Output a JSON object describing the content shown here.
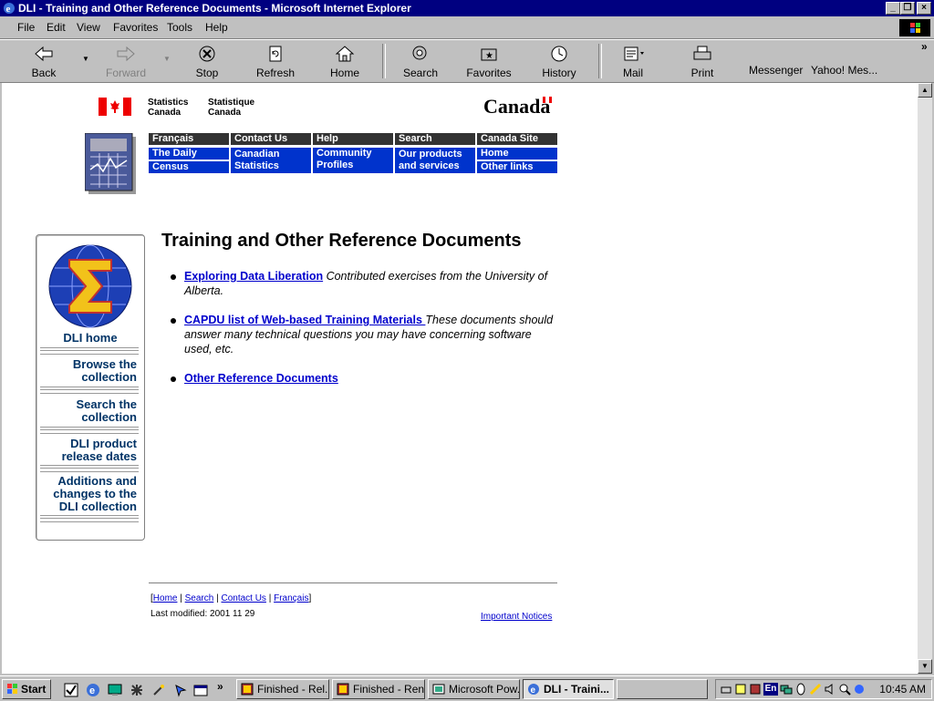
{
  "window": {
    "title": "DLI - Training and Other Reference Documents - Microsoft Internet Explorer"
  },
  "menu": [
    "File",
    "Edit",
    "View",
    "Favorites",
    "Tools",
    "Help"
  ],
  "toolbar": {
    "back": "Back",
    "forward": "Forward",
    "stop": "Stop",
    "refresh": "Refresh",
    "home": "Home",
    "search": "Search",
    "favorites": "Favorites",
    "history": "History",
    "mail": "Mail",
    "print": "Print",
    "messenger": "Messenger",
    "yahoo": "Yahoo! Mes...",
    "chevron": "»"
  },
  "header": {
    "stats_en_1": "Statistics",
    "stats_en_2": "Canada",
    "stats_fr_1": "Statistique",
    "stats_fr_2": "Canada",
    "canada_wordmark": "Canada"
  },
  "nav": {
    "francais": "Français",
    "contact": "Contact Us",
    "help": "Help",
    "search": "Search",
    "canada_site": "Canada Site",
    "daily": "The Daily",
    "census": "Census",
    "canadian_stats_1": "Canadian",
    "canadian_stats_2": "Statistics",
    "community_1": "Community",
    "community_2": "Profiles",
    "products_1": "Our products",
    "products_2": "and services",
    "home": "Home",
    "other_links": "Other links"
  },
  "leftnav": {
    "dli_home": "DLI home",
    "browse_1": "Browse the",
    "browse_2": "collection",
    "search_1": "Search the",
    "search_2": "collection",
    "release_1": "DLI product",
    "release_2": "release dates",
    "additions_1": "Additions and",
    "additions_2": "changes to the",
    "additions_3": "DLI collection"
  },
  "main": {
    "title": "Training and Other Reference Documents",
    "items": [
      {
        "link": "Exploring Data Liberation",
        "desc": " Contributed exercises from the University of Alberta."
      },
      {
        "link": "CAPDU list of Web-based Training Materials ",
        "desc": "These documents should answer many technical questions you may have concerning software used, etc."
      },
      {
        "link": "Other Reference Documents",
        "desc": ""
      }
    ]
  },
  "footer": {
    "home": "Home",
    "search": "Search",
    "contact": "Contact Us",
    "francais": "Français",
    "last_modified": "Last modified: 2001 11 29",
    "notices": "Important Notices"
  },
  "taskbar": {
    "start": "Start",
    "tasks": [
      "Finished - Rel...",
      "Finished - Ren...",
      "Microsoft Pow...",
      "DLI - Traini..."
    ],
    "clock": "10:45 AM",
    "lang": "En"
  },
  "colors": {
    "titlebar": "#000080",
    "nav_dark": "#333333",
    "nav_blue": "#0033cc",
    "link": "#0000cc",
    "leftnav_text": "#003366"
  }
}
